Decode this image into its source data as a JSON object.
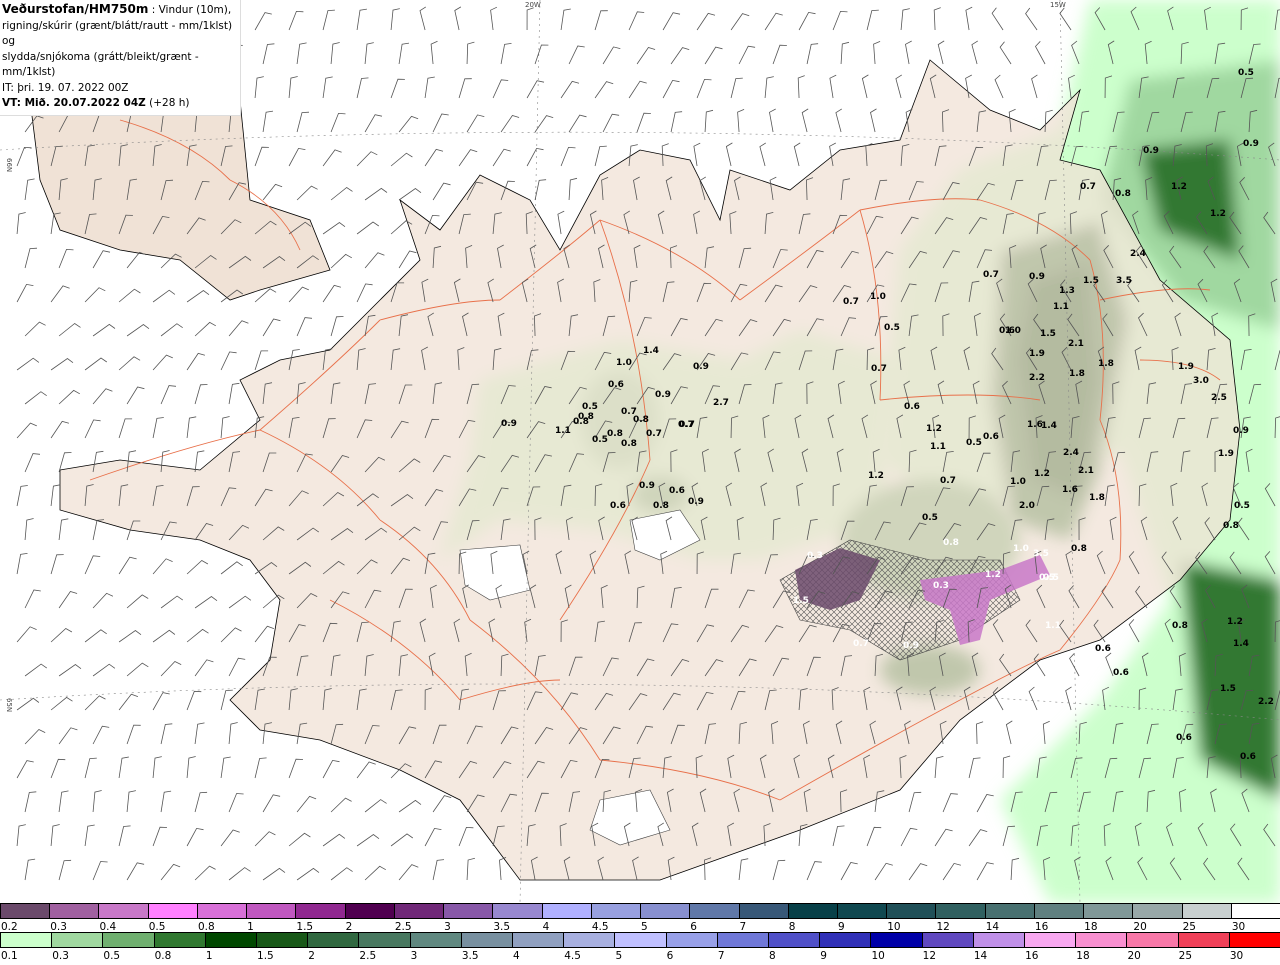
{
  "header": {
    "title": "Veðurstofan/HM750m",
    "description_line1": " : Vindur (10m),",
    "description_line2": "rigning/skúrir (grænt/blátt/rautt - mm/1klst) og",
    "description_line3": "slydda/snjókoma (grátt/bleikt/grænt - mm/1klst)",
    "issue_time": "IT: þri. 19. 07. 2022 00Z",
    "valid_label": "VT: Mið. 20.07.2022 04Z",
    "lead_time": " (+28 h)"
  },
  "map": {
    "grid_labels": {
      "lon_20w": "20W",
      "lon_15w": "15W",
      "lat_66n": "66N",
      "lat_65n": "65N"
    },
    "colors": {
      "land": "#f0e2d6",
      "sea": "#ffffff",
      "roads": "#e8704a",
      "coast": "#000000",
      "barbs": "#555555"
    },
    "precip_labels": [
      "0.5",
      "0.7",
      "0.9",
      "0.9",
      "0.8",
      "1.2",
      "1.2",
      "2.4",
      "0.7",
      "0.9",
      "1.3",
      "1.5",
      "3.5",
      "0.7",
      "1.0",
      "0.5",
      "0.6",
      "1.1",
      "1.9",
      "2.1",
      "1.8",
      "2.2",
      "1.8",
      "1.5",
      "1.9",
      "3.0",
      "2.5",
      "1.4",
      "1.0",
      "0.9",
      "1.9",
      "0.5",
      "0.8",
      "1.6",
      "2.4",
      "2.1",
      "1.6",
      "1.0",
      "1.2",
      "2.0",
      "1.8",
      "0.8",
      "0.5",
      "1.0",
      "0.8",
      "1.2",
      "3.5",
      "0.5",
      "0.8",
      "1.2",
      "1.4",
      "1.5",
      "2.2",
      "0.6",
      "0.6",
      "0.6",
      "0.6",
      "1.1",
      "0.7",
      "0.3",
      "0.3",
      "1.5",
      "0.9",
      "0.7",
      "0.5",
      "0.6",
      "1.2",
      "1.1",
      "0.5",
      "0.6",
      "0.7",
      "1.2",
      "0.9",
      "1.4",
      "1.0",
      "0.7",
      "0.9",
      "0.8",
      "1.1",
      "0.7",
      "0.5",
      "0.8",
      "0.7",
      "0.8",
      "0.5",
      "0.6",
      "0.8",
      "0.8",
      "0.7",
      "0.9",
      "0.9",
      "0.6",
      "0.8",
      "0.6",
      "0.9",
      "2.7"
    ]
  },
  "legend": {
    "snow": {
      "labels": [
        "0.2",
        "0.3",
        "0.4",
        "0.5",
        "0.8",
        "1",
        "1.5",
        "2",
        "2.5",
        "3",
        "3.5",
        "4",
        "4.5",
        "5",
        "6",
        "7",
        "8",
        "9",
        "10",
        "12",
        "14",
        "16",
        "18",
        "20",
        "25",
        "30"
      ],
      "colors": [
        "#6b4a6b",
        "#a060a0",
        "#c878c8",
        "#ff80ff",
        "#d870d8",
        "#c058c0",
        "#902890",
        "#500050",
        "#702878",
        "#8858a8",
        "#9888d0",
        "#b0b0ff",
        "#98a0e0",
        "#8890d0",
        "#6078a8",
        "#385878",
        "#084048",
        "#104850",
        "#205058",
        "#306060",
        "#487070",
        "#608080",
        "#809898",
        "#98a8a8",
        "#c8d0d0",
        "#ffffff"
      ]
    },
    "rain": {
      "labels": [
        "0.1",
        "0.3",
        "0.5",
        "0.8",
        "1",
        "1.5",
        "2",
        "2.5",
        "3",
        "3.5",
        "4",
        "4.5",
        "5",
        "6",
        "7",
        "8",
        "9",
        "10",
        "12",
        "14",
        "16",
        "18",
        "20",
        "25",
        "30"
      ],
      "colors": [
        "#ccffcc",
        "#a0d8a0",
        "#70b070",
        "#307830",
        "#004800",
        "#185818",
        "#306840",
        "#487860",
        "#608880",
        "#7890a0",
        "#90a0c0",
        "#a8b0e0",
        "#c0c0ff",
        "#98a0e8",
        "#7078d8",
        "#5050c8",
        "#3030b8",
        "#0000a8",
        "#6048c0",
        "#c090e8",
        "#f8a8f0",
        "#f890d0",
        "#f878a8",
        "#f04058",
        "#ff0000"
      ]
    }
  }
}
